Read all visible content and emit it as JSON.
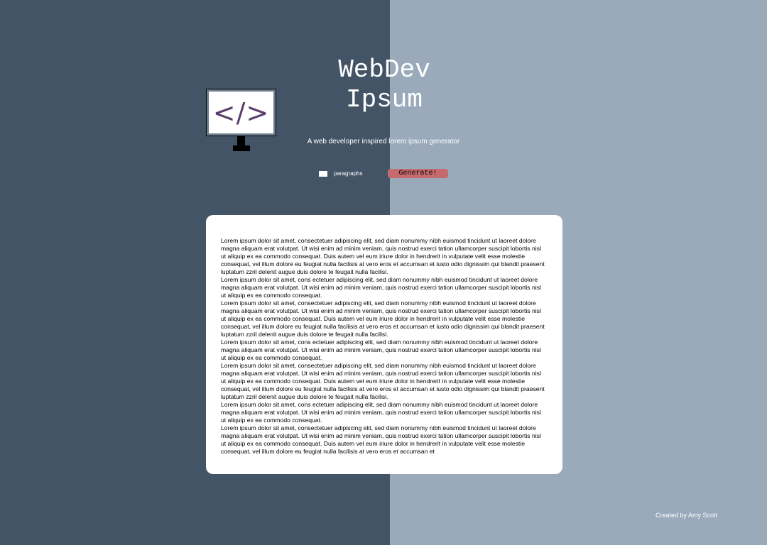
{
  "header": {
    "title_line1": "WebDev",
    "title_line2": "Ipsum",
    "subtitle": "A web developer inspired lorem ipsum generator",
    "logo_symbol": "</>"
  },
  "controls": {
    "paragraphs_value": "",
    "paragraphs_label": "paragraphs",
    "generate_label": "Generate!"
  },
  "output": {
    "paragraphs": [
      "Lorem ipsum dolor sit amet, consectetuer adipiscing elit, sed diam nonummy nibh euismod tincidunt ut laoreet dolore magna aliquam erat volutpat. Ut wisi enim ad minim veniam, quis nostrud exerci tation ullamcorper suscipit lobortis nisl ut aliquip ex ea commodo consequat. Duis autem vel eum iriure dolor in hendrerit in vulputate velit esse molestie consequat, vel illum dolore eu feugiat nulla facilisis at vero eros et accumsan et iusto odio dignissim qui blandit praesent luptatum zzril delenit augue duis dolore te feugait nulla facilisi.",
      "Lorem ipsum dolor sit amet, cons ectetuer adipiscing elit, sed diam nonummy nibh euismod tincidunt ut laoreet dolore magna aliquam erat volutpat. Ut wisi enim ad minim veniam, quis nostrud exerci tation ullamcorper suscipit lobortis nisl ut aliquip ex ea commodo consequat.",
      "Lorem ipsum dolor sit amet, consectetuer adipiscing elit, sed diam nonummy nibh euismod tincidunt ut laoreet dolore magna aliquam erat volutpat. Ut wisi enim ad minim veniam, quis nostrud exerci tation ullamcorper suscipit lobortis nisl ut aliquip ex ea commodo consequat. Duis autem vel eum iriure dolor in hendrerit in vulputate velit esse molestie consequat, vel illum dolore eu feugiat nulla facilisis at vero eros et accumsan et iusto odio dignissim qui blandit praesent luptatum zzril delenit augue duis dolore te feugait nulla facilisi.",
      "Lorem ipsum dolor sit amet, cons ectetuer adipiscing elit, sed diam nonummy nibh euismod tincidunt ut laoreet dolore magna aliquam erat volutpat. Ut wisi enim ad minim veniam, quis nostrud exerci tation ullamcorper suscipit lobortis nisl ut aliquip ex ea commodo consequat.",
      "Lorem ipsum dolor sit amet, consectetuer adipiscing elit, sed diam nonummy nibh euismod tincidunt ut laoreet dolore magna aliquam erat volutpat. Ut wisi enim ad minim veniam, quis nostrud exerci tation ullamcorper suscipit lobortis nisl ut aliquip ex ea commodo consequat. Duis autem vel eum iriure dolor in hendrerit in vulputate velit esse molestie consequat, vel illum dolore eu feugiat nulla facilisis at vero eros et accumsan et iusto odio dignissim qui blandit praesent luptatum zzril delenit augue duis dolore te feugait nulla facilisi.",
      "Lorem ipsum dolor sit amet, cons ectetuer adipiscing elit, sed diam nonummy nibh euismod tincidunt ut laoreet dolore magna aliquam erat volutpat. Ut wisi enim ad minim veniam, quis nostrud exerci tation ullamcorper suscipit lobortis nisl ut aliquip ex ea commodo consequat.",
      "Lorem ipsum dolor sit amet, consectetuer adipiscing elit, sed diam nonummy nibh euismod tincidunt ut laoreet dolore magna aliquam erat volutpat. Ut wisi enim ad minim veniam, quis nostrud exerci tation ullamcorper suscipit lobortis nisl ut aliquip ex ea commodo consequat. Duis autem vel eum iriure dolor in hendrerit in vulputate velit esse molestie consequat, vel illum dolore eu feugiat nulla facilisis at vero eros et accumsan et"
    ]
  },
  "footer": {
    "credit": "Created by Amy Scott"
  },
  "colors": {
    "left_panel": "#435467",
    "right_panel": "#9aaabb",
    "generate_button": "#c56a6e",
    "logo_symbol": "#5a3e6c"
  },
  "icons": {
    "logo": "monitor-code-icon"
  }
}
